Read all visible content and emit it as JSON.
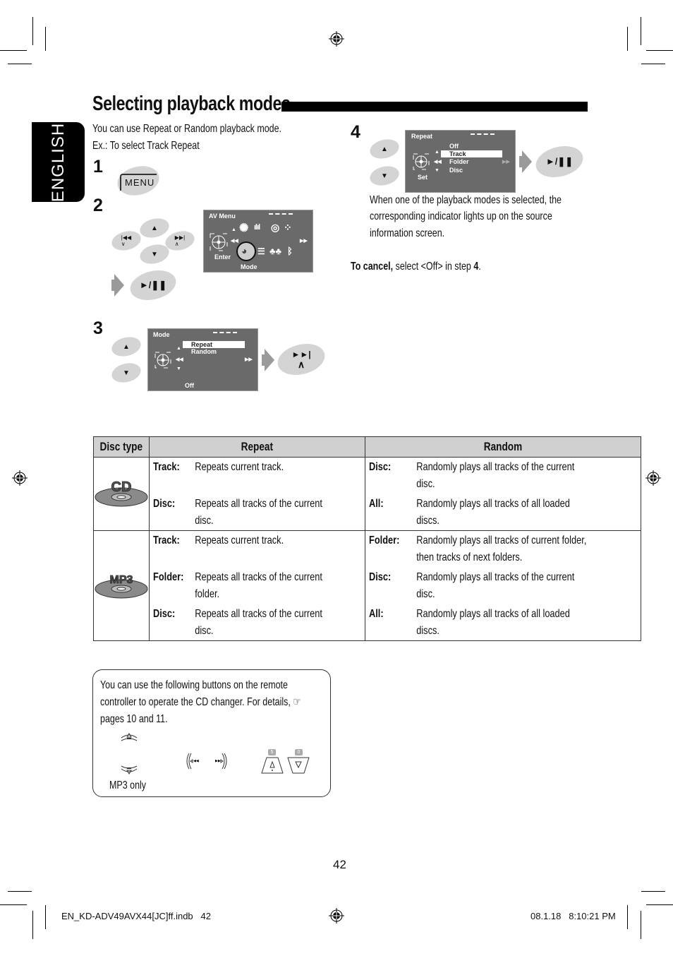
{
  "language_tab": "ENGLISH",
  "title": "Selecting playback modes",
  "intro": {
    "line1": "You can use Repeat or Random playback mode.",
    "line2": "Ex.:  To select Track Repeat"
  },
  "steps": {
    "s1": {
      "number": "1",
      "button_label": "MENU"
    },
    "s2": {
      "number": "2",
      "screen": {
        "title": "AV Menu",
        "enter_label": "Enter",
        "selected_label": "Mode"
      },
      "play_pause_label": "►/❚❚"
    },
    "s3": {
      "number": "3",
      "screen": {
        "title": "Mode",
        "items": [
          "Repeat",
          "Random"
        ],
        "selected_index": 0,
        "footer_label": "Off"
      },
      "next_label": "►►|"
    },
    "s4": {
      "number": "4",
      "screen": {
        "title": "Repeat",
        "items": [
          "Off",
          "Track",
          "Folder",
          "Disc"
        ],
        "selected_index": 1,
        "set_label": "Set"
      },
      "play_pause_label": "►/❚❚",
      "description": [
        "When one of the playback modes is selected, the",
        "corresponding indicator lights up on the source",
        "information screen."
      ]
    }
  },
  "cancel_note": {
    "bold": "To cancel,",
    "rest": " select <Off> in step ",
    "step": "4",
    "end": "."
  },
  "table": {
    "headers": [
      "Disc type",
      "Repeat",
      "Random"
    ],
    "rows": [
      {
        "disc_label": "CD",
        "repeat": [
          {
            "key": "Track:",
            "lines": [
              "Repeats current track.",
              ""
            ]
          },
          {
            "key": "Disc:",
            "lines": [
              "Repeats all tracks of the current",
              "disc."
            ]
          }
        ],
        "random": [
          {
            "key": "Disc:",
            "lines": [
              "Randomly plays all tracks of the current",
              "disc."
            ]
          },
          {
            "key": "All:",
            "lines": [
              "Randomly plays all tracks of all loaded",
              "discs."
            ]
          }
        ]
      },
      {
        "disc_label": "MP3",
        "repeat": [
          {
            "key": "Track:",
            "lines": [
              "Repeats current track.",
              ""
            ]
          },
          {
            "key": "Folder:",
            "lines": [
              "Repeats all tracks of the current",
              "folder."
            ]
          },
          {
            "key": "Disc:",
            "lines": [
              "Repeats all tracks of the current",
              "disc."
            ]
          }
        ],
        "random": [
          {
            "key": "Folder:",
            "lines": [
              "Randomly plays all tracks of current folder,",
              "then tracks of next folders."
            ]
          },
          {
            "key": "Disc:",
            "lines": [
              "Randomly plays all tracks of the current",
              "disc."
            ]
          },
          {
            "key": "All:",
            "lines": [
              "Randomly plays all tracks of all loaded",
              "discs."
            ]
          }
        ]
      }
    ]
  },
  "remote_note": {
    "lines": [
      "You can use the following buttons on the remote",
      "controller to operate the CD changer. For details, ☞",
      "pages 10 and 11."
    ],
    "mp3_only": "MP3 only",
    "btn_up_number": "5",
    "btn_down_number": "0"
  },
  "page_number": "42",
  "footer": {
    "file": "EN_KD-ADV49AVX44[JC]ff.indb   42",
    "datetime": "08.1.18   8:10:21 PM"
  }
}
